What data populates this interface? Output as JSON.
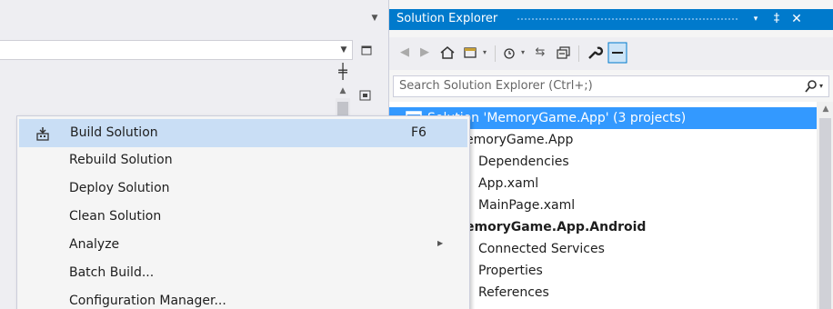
{
  "solution_explorer": {
    "title": "Solution Explorer",
    "title_buttons": {
      "dropdown": "▾",
      "pin": "‡",
      "close": "✕"
    },
    "search_placeholder": "Search Solution Explorer (Ctrl+;)",
    "search_icon": "search-icon",
    "tree": [
      {
        "label": "Solution 'MemoryGame.App' (3 projects)",
        "selected": true
      },
      {
        "label": "emoryGame.App"
      },
      {
        "label": "Dependencies"
      },
      {
        "label": "App.xaml"
      },
      {
        "label": "MainPage.xaml"
      },
      {
        "label": "emoryGame.App.Android",
        "bold": true
      },
      {
        "label": "Connected Services"
      },
      {
        "label": "Properties"
      },
      {
        "label": "References"
      }
    ]
  },
  "context_menu": {
    "items": [
      {
        "label": "Build Solution",
        "shortcut": "F6",
        "icon": "build-icon",
        "highlighted": true
      },
      {
        "label": "Rebuild Solution"
      },
      {
        "label": "Deploy Solution"
      },
      {
        "label": "Clean Solution"
      },
      {
        "label": "Analyze",
        "has_submenu": true
      },
      {
        "label": "Batch Build..."
      },
      {
        "label": "Configuration Manager..."
      }
    ]
  },
  "colors": {
    "accent": "#007acc",
    "selection": "#3399ff",
    "menu_highlight": "#c9def5"
  }
}
